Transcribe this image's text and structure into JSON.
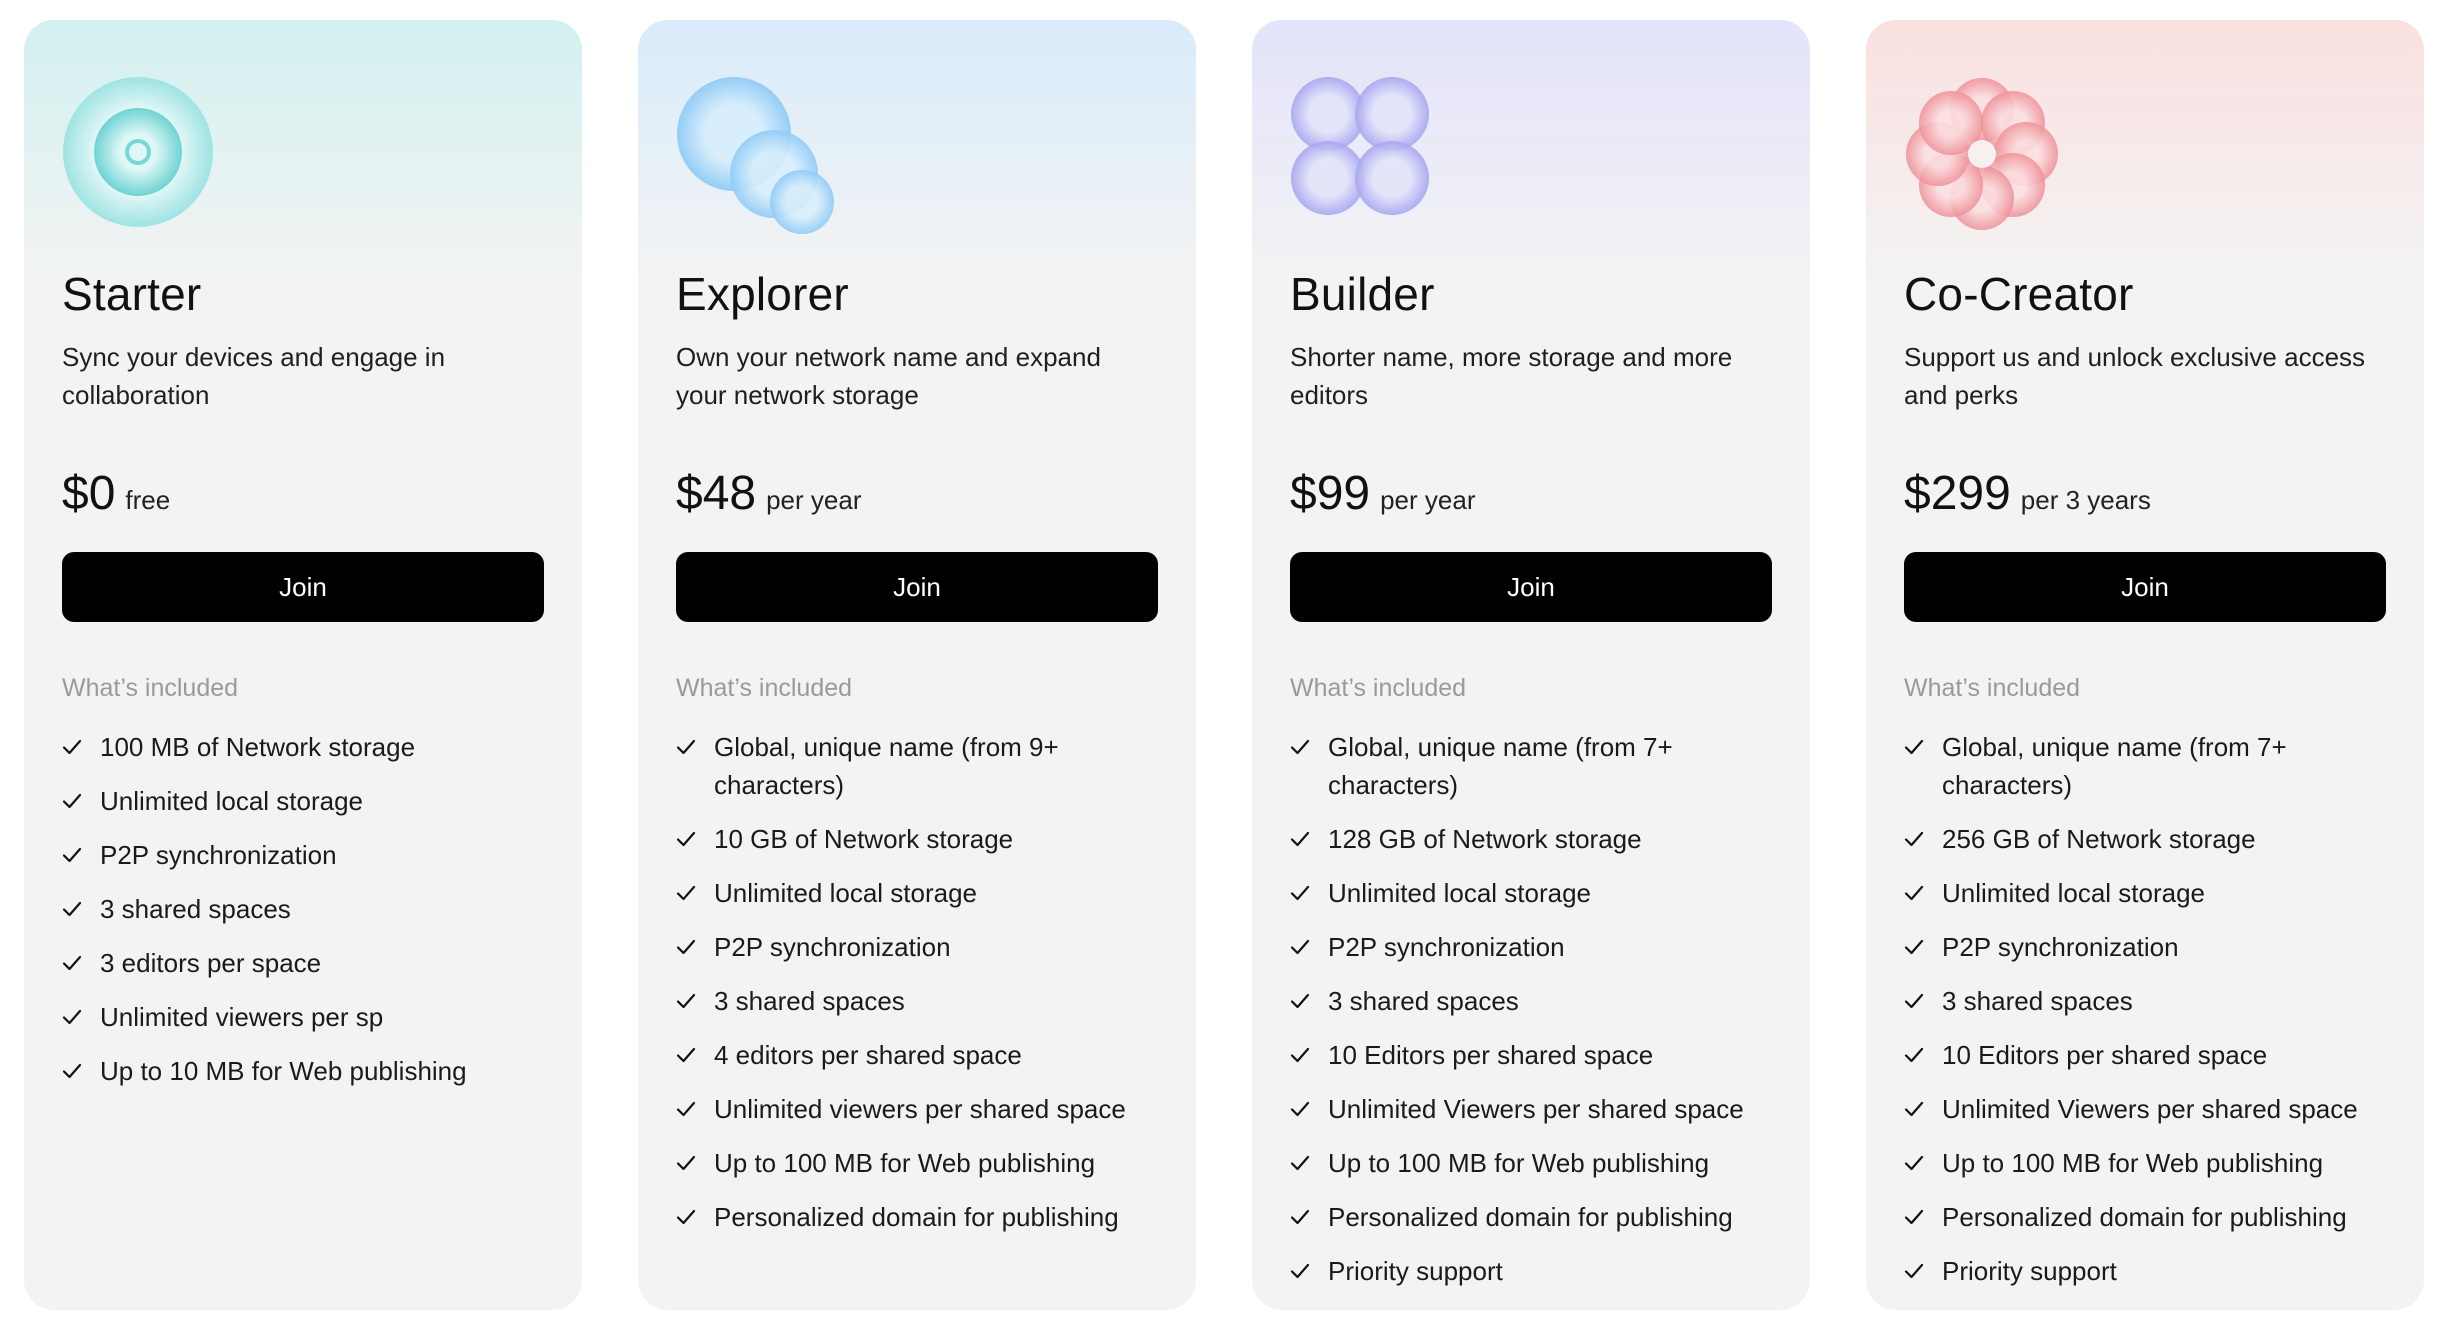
{
  "included_heading": "What’s included",
  "plans": [
    {
      "name": "Starter",
      "description": "Sync your devices and engage in collaboration",
      "price": "$0",
      "period": "free",
      "button": "Join",
      "accent": "#7fd8d8",
      "logo": "concentric-circles-icon",
      "features": [
        "100 MB of Network storage",
        "Unlimited local storage",
        "P2P synchronization",
        "3 shared spaces",
        "3 editors per space",
        "Unlimited viewers per sp",
        "Up to 10 MB for Web publishing"
      ]
    },
    {
      "name": "Explorer",
      "description": "Own your network name and expand your network storage",
      "price": "$48",
      "period": "per year",
      "button": "Join",
      "accent": "#8cc8f5",
      "logo": "bubbles-icon",
      "features": [
        "Global, unique name (from 9+ characters)",
        "10 GB of Network storage",
        "Unlimited local storage",
        "P2P synchronization",
        "3 shared spaces",
        "4 editors per shared space",
        "Unlimited viewers per shared space",
        "Up to 100 MB for Web publishing",
        "Personalized domain for publishing"
      ]
    },
    {
      "name": "Builder",
      "description": "Shorter name, more storage and more editors",
      "price": "$99",
      "period": "per year",
      "button": "Join",
      "accent": "#a8a8f0",
      "logo": "four-circles-icon",
      "features": [
        "Global, unique name (from 7+ characters)",
        "128 GB of Network storage",
        "Unlimited local storage",
        "P2P synchronization",
        "3 shared spaces",
        "10 Editors per shared space",
        "Unlimited Viewers per shared space",
        "Up to 100 MB for Web publishing",
        "Personalized domain for publishing",
        "Priority support"
      ]
    },
    {
      "name": "Co-Creator",
      "description": "Support us and unlock exclusive access and perks",
      "price": "$299",
      "period": "per 3 years",
      "button": "Join",
      "accent": "#f09aa0",
      "logo": "flower-icon",
      "features": [
        "Global, unique name (from 7+ characters)",
        "256 GB of Network storage",
        "Unlimited local storage",
        "P2P synchronization",
        "3 shared spaces",
        "10 Editors per shared space",
        "Unlimited Viewers per shared space",
        "Up to 100 MB for Web publishing",
        "Personalized domain for publishing",
        "Priority support"
      ]
    }
  ]
}
